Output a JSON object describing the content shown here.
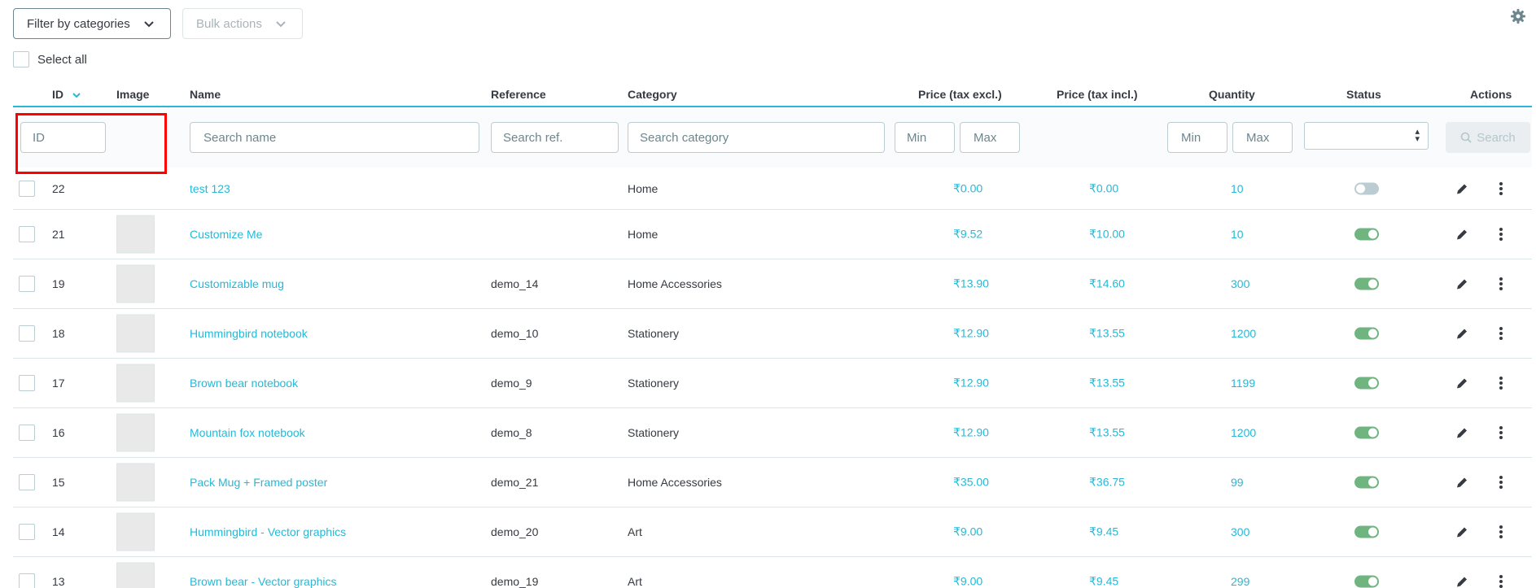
{
  "toolbar": {
    "filter_label": "Filter by categories",
    "bulk_label": "Bulk actions",
    "select_all_label": "Select all",
    "settings_icon": "gear-icon"
  },
  "columns": {
    "id": "ID",
    "image": "Image",
    "name": "Name",
    "reference": "Reference",
    "category": "Category",
    "price_excl": "Price (tax excl.)",
    "price_incl": "Price (tax incl.)",
    "quantity": "Quantity",
    "status": "Status",
    "actions": "Actions"
  },
  "filters": {
    "id_placeholder": "ID",
    "name_placeholder": "Search name",
    "ref_placeholder": "Search ref.",
    "category_placeholder": "Search category",
    "price_min": "Min",
    "price_max": "Max",
    "qty_min": "Min",
    "qty_max": "Max",
    "search_label": "Search"
  },
  "rows": [
    {
      "id": "22",
      "has_image": false,
      "name": "test 123",
      "reference": "",
      "category": "Home",
      "price_excl": "₹0.00",
      "price_incl": "₹0.00",
      "quantity": "10",
      "active": false
    },
    {
      "id": "21",
      "has_image": true,
      "name": "Customize Me",
      "reference": "",
      "category": "Home",
      "price_excl": "₹9.52",
      "price_incl": "₹10.00",
      "quantity": "10",
      "active": true
    },
    {
      "id": "19",
      "has_image": true,
      "name": "Customizable mug",
      "reference": "demo_14",
      "category": "Home Accessories",
      "price_excl": "₹13.90",
      "price_incl": "₹14.60",
      "quantity": "300",
      "active": true
    },
    {
      "id": "18",
      "has_image": true,
      "name": "Hummingbird notebook",
      "reference": "demo_10",
      "category": "Stationery",
      "price_excl": "₹12.90",
      "price_incl": "₹13.55",
      "quantity": "1200",
      "active": true
    },
    {
      "id": "17",
      "has_image": true,
      "name": "Brown bear notebook",
      "reference": "demo_9",
      "category": "Stationery",
      "price_excl": "₹12.90",
      "price_incl": "₹13.55",
      "quantity": "1199",
      "active": true
    },
    {
      "id": "16",
      "has_image": true,
      "name": "Mountain fox notebook",
      "reference": "demo_8",
      "category": "Stationery",
      "price_excl": "₹12.90",
      "price_incl": "₹13.55",
      "quantity": "1200",
      "active": true
    },
    {
      "id": "15",
      "has_image": true,
      "name": "Pack Mug + Framed poster",
      "reference": "demo_21",
      "category": "Home Accessories",
      "price_excl": "₹35.00",
      "price_incl": "₹36.75",
      "quantity": "99",
      "active": true
    },
    {
      "id": "14",
      "has_image": true,
      "name": "Hummingbird - Vector graphics",
      "reference": "demo_20",
      "category": "Art",
      "price_excl": "₹9.00",
      "price_incl": "₹9.45",
      "quantity": "300",
      "active": true
    },
    {
      "id": "13",
      "has_image": true,
      "name": "Brown bear - Vector graphics",
      "reference": "demo_19",
      "category": "Art",
      "price_excl": "₹9.00",
      "price_incl": "₹9.45",
      "quantity": "299",
      "active": true
    }
  ],
  "colors": {
    "accent": "#25b9d7",
    "toggle_on": "#70b580",
    "toggle_off": "#bbcdd2",
    "highlight": "#ff0000"
  }
}
